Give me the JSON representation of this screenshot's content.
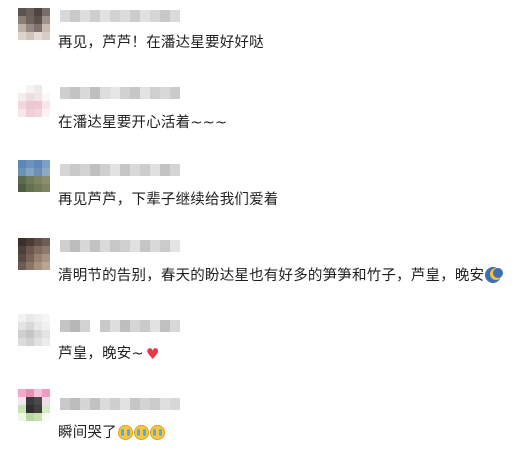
{
  "comments": [
    {
      "text": "再见，芦芦！在潘达星要好好哒",
      "avatar_colors": [
        "#5b5350",
        "#6a605c",
        "#4d4542",
        "#7a6e68",
        "#8b7f78",
        "#6f635e",
        "#5c524d",
        "#a0938b",
        "#bdb0a8",
        "#958a83",
        "#7e726c",
        "#c8bbb2",
        "#ddd3cb",
        "#cfc4bc",
        "#e4dbd4",
        "#d7cdc5"
      ],
      "name_colors": [
        "#d8d8d8",
        "#c9c9c9",
        "#dedede",
        "#cfcfcf",
        "#e2e2e2",
        "#d3d3d3",
        "#dcdcdc",
        "#cccccc",
        "#e0e0e0",
        "#d6d6d6",
        "#c8c8c8",
        "#dadada"
      ]
    },
    {
      "text": "在潘达星要开心活着~~~",
      "avatar_colors": [
        "#ffffff",
        "#f7f3f3",
        "#efe9e9",
        "#ffffff",
        "#f3eded",
        "#eadede",
        "#f1e6e6",
        "#fbf7f7",
        "#f4d7de",
        "#ecc8d0",
        "#f3c6d2",
        "#f7e7eb",
        "#f8e6ea",
        "#f0cfd7",
        "#f4d5dc",
        "#fcf2f4"
      ],
      "name_colors": [
        "#cfcfcf",
        "#c4c4c4",
        "#d9d9d9",
        "#bfbfbf",
        "#dddddd",
        "#e6e6e6",
        "#d1d1d1",
        "#c7c7c7",
        "#e3e3e3",
        "#d0d0d0",
        "#d8d8d8",
        "#cbcbcb"
      ]
    },
    {
      "text": "再见芦芦，下辈子继续给我们爱着",
      "avatar_colors": [
        "#5b87b5",
        "#6a93bd",
        "#5e89b7",
        "#7aa0c6",
        "#6d91b3",
        "#84a4c3",
        "#6e90b2",
        "#8ea9c4",
        "#5c6b4f",
        "#6f7a5a",
        "#7e8660",
        "#8a8e6b",
        "#4f5e43",
        "#64704f",
        "#6f7b55",
        "#7e8560"
      ],
      "name_colors": [
        "#d6d6d6",
        "#c9c9c9",
        "#d2d2d2",
        "#c0c0c0",
        "#cfcfcf",
        "#e2e2e2",
        "#c6c6c6",
        "#d9d9d9",
        "#cdcdcd",
        "#e0e0e0",
        "#c3c3c3",
        "#d4d4d4"
      ]
    },
    {
      "text": "清明节的告别，春天的盼达星也有好多的笋笋和竹子，芦皇，晚安",
      "avatar_colors": [
        "#3b2f2c",
        "#4a3b37",
        "#5e4c46",
        "#6e5c55",
        "#4f3f3a",
        "#6b5750",
        "#80695f",
        "#8e776c",
        "#5a4842",
        "#77625a",
        "#96806f",
        "#a89281",
        "#6d5a52",
        "#8b7566",
        "#a78f7c",
        "#bca590"
      ],
      "name_colors": [
        "#cfcfcf",
        "#bdbdbd",
        "#d7d7d7",
        "#c3c3c3",
        "#dadada",
        "#c8c8c8",
        "#d0d0d0",
        "#e1e1e1",
        "#c6c6c6",
        "#d9d9d9",
        "#cbcbcb",
        "#e4e4e4"
      ]
    },
    {
      "text": "芦皇，晚安~",
      "avatar_colors": [
        "#f1f1f1",
        "#e9e9e9",
        "#efefef",
        "#f6f6f6",
        "#e3e3e3",
        "#d8d8d8",
        "#e8e8e8",
        "#f0f0f0",
        "#cfcfcf",
        "#c5c5c5",
        "#d7d7d7",
        "#e4e4e4",
        "#dcdcdc",
        "#d2d2d2",
        "#e1e1e1",
        "#ececec"
      ],
      "name_colors": [
        "#c4c4c4",
        "#b7b7b7",
        "#d3d3d3",
        "#ffffff",
        "#c9c9c9",
        "#dedede",
        "#bebebe",
        "#d6d6d6",
        "#cacaca",
        "#e2e2e2",
        "#c0c0c0",
        "#d8d8d8"
      ]
    },
    {
      "text": "瞬间哭了",
      "avatar_colors": [
        "#f3a9c9",
        "#e88fb8",
        "#f6c0d7",
        "#ee9cc2",
        "#f3e6ee",
        "#3a3a3a",
        "#4a4a4a",
        "#f0dce7",
        "#c9e3b5",
        "#2f2f2f",
        "#404040",
        "#d7ebc6",
        "#eef6e6",
        "#b8d8a2",
        "#c6e0b0",
        "#f7fbf4"
      ],
      "name_colors": [
        "#c9c9c9",
        "#bcbcbc",
        "#d6d6d6",
        "#c2c2c2",
        "#dcdcdc",
        "#cfcfcf",
        "#e2e2e2",
        "#c6c6c6",
        "#d3d3d3",
        "#cbcbcb",
        "#dfdfdf",
        "#d8d8d8"
      ]
    }
  ],
  "emoji": {
    "goodnight": "sleepy-moon-icon",
    "heart": "♥",
    "crying": "crying-face-icon"
  },
  "colors": {
    "heart": "#e8394a",
    "text": "#1f1f1f"
  }
}
